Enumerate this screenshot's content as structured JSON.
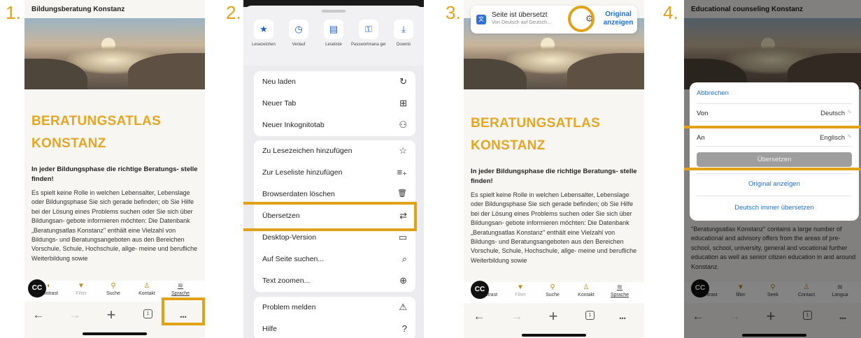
{
  "steps": [
    "1.",
    "2.",
    "3.",
    "4."
  ],
  "page": {
    "site_title_de": "Bildungsberatung Konstanz",
    "site_title_en": "Educational counseling Konstanz",
    "heading_line1": "BERATUNGSATLAS",
    "heading_line2": "KONSTANZ",
    "subhead": "In jeder Bildungsphase die richtige Beratungs- stelle finden!",
    "body_de": "Es spielt keine Rolle in welchen Lebensalter, Lebenslage oder Bildungsphase Sie sich gerade befinden; ob Sie Hilfe bei der Lösung eines Problems suchen oder Sie sich über Bildungsan- gebote informieren möchten: Die Datenbank „Beratungsatlas Konstanz\" enthält eine Vielzahl von Bildungs- und Beratungsangeboten aus den Bereichen Vorschule, Schule, Hochschule, allge- meine und berufliche Weiterbildung sowie",
    "body_en": "\"Beratungsatlas Konstanz\" contains a large number of educational and advisory offers from the areas of pre-school, school, university, general and vocational further education as well as senior citizen education in and around Konstanz."
  },
  "toolbar_de": {
    "cc": "CC",
    "items": [
      "Kontrast",
      "Filter",
      "Suche",
      "Kontakt",
      "Sprache"
    ]
  },
  "toolbar_en": {
    "cc": "CC",
    "items": [
      "contrast",
      "filter",
      "Seek",
      "Contact",
      "Langua"
    ]
  },
  "browser_nav": {
    "back": "←",
    "forward": "→",
    "new_tab": "+",
    "tab_count": "1",
    "more": "•••"
  },
  "menu": {
    "quick_actions": [
      "Lesezeichen",
      "Verlauf",
      "Leseliste",
      "Passwortmana ger",
      "Downlo"
    ],
    "group1": [
      {
        "label": "Neu laden",
        "icon": "↻"
      },
      {
        "label": "Neuer Tab",
        "icon": "⊞"
      },
      {
        "label": "Neuer Inkognitotab",
        "icon": "⚇"
      }
    ],
    "group2": [
      {
        "label": "Zu Lesezeichen hinzufügen",
        "icon": "☆"
      },
      {
        "label": "Zur Leseliste hinzufügen",
        "icon": "≡₊"
      },
      {
        "label": "Browserdaten löschen",
        "icon": "🗑"
      },
      {
        "label": "Übersetzen",
        "icon": "⇄"
      },
      {
        "label": "Desktop-Version",
        "icon": "▭"
      },
      {
        "label": "Auf Seite suchen...",
        "icon": "⌕"
      },
      {
        "label": "Text zoomen...",
        "icon": "⊕"
      }
    ],
    "group3": [
      {
        "label": "Problem melden",
        "icon": "⚠"
      },
      {
        "label": "Hilfe",
        "icon": "?"
      }
    ]
  },
  "translate_banner": {
    "title": "Seite ist übersetzt",
    "subtitle": "Von Deutsch auf Deutsch…",
    "show_original": "Original anzeigen"
  },
  "translate_dialog": {
    "cancel": "Abbrechen",
    "from_label": "Von",
    "from_value": "Deutsch",
    "to_label": "An",
    "to_value": "Englisch",
    "translate_button": "Übersetzen",
    "show_original": "Original anzeigen",
    "always_translate": "Deutsch immer übersetzen"
  },
  "colors": {
    "accent": "#e1a21a",
    "heading": "#e6a623",
    "link": "#1f6fde"
  }
}
